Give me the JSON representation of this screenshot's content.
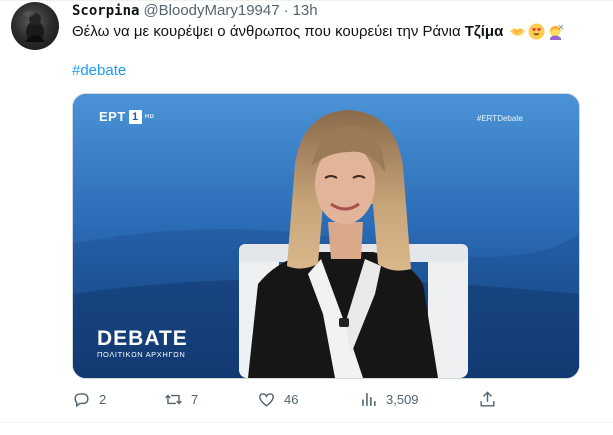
{
  "tweet": {
    "author_name": "Scorpina",
    "handle": "@BloodyMary19947",
    "separator": "·",
    "time": "13h",
    "text": "Θέλω να με κουρέψει ο άνθρωπος που κουρεύει την Ράνια",
    "text_bold": "Τζίμα",
    "emojis": [
      "handshake-emoji",
      "heart-eyes-emoji",
      "haircut-emoji"
    ],
    "hashtag": "#debate"
  },
  "media": {
    "channel_logo": "ΕΡΤ",
    "channel_number": "1",
    "channel_hd": "HD",
    "overlay_hashtag": "#ERTDebate",
    "show_title": "DEBATE",
    "show_subtitle": "ΠΟΛΙΤΙΚΩΝ ΑΡΧΗΓΩΝ"
  },
  "actions": {
    "reply_count": "2",
    "retweet_count": "7",
    "like_count": "46",
    "views_count": "3,509",
    "icons": [
      "reply-icon",
      "retweet-icon",
      "like-icon",
      "views-icon",
      "share-icon"
    ]
  },
  "colors": {
    "link": "#1d9bf0",
    "secondary_text": "#536471",
    "primary_text": "#0f1419",
    "studio_blue": "#2c6fb9"
  }
}
